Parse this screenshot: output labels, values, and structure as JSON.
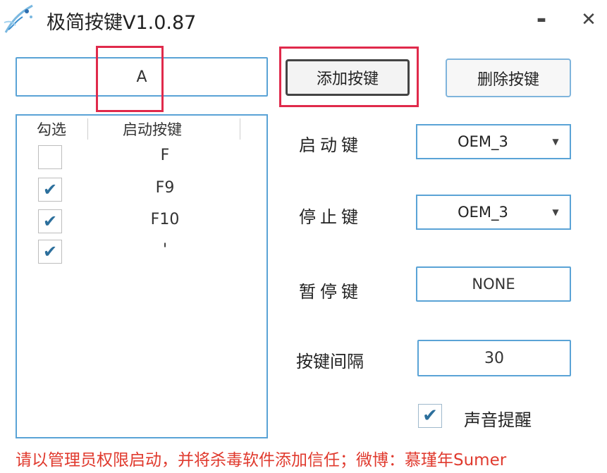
{
  "window": {
    "title": "极简按键V1.0.87",
    "minimize_label": "▬",
    "close_label": "✕"
  },
  "key_input": {
    "value": "A"
  },
  "buttons": {
    "add_label": "添加按键",
    "delete_label": "删除按键"
  },
  "list": {
    "headers": {
      "check": "勾选",
      "key": "启动按键"
    },
    "rows": [
      {
        "checked": false,
        "key": "F"
      },
      {
        "checked": true,
        "key": "F9"
      },
      {
        "checked": true,
        "key": "F10"
      },
      {
        "checked": true,
        "key": "'"
      }
    ]
  },
  "settings": {
    "start_label": "启动键",
    "start_value": "OEM_3",
    "stop_label": "停止键",
    "stop_value": "OEM_3",
    "pause_label": "暂停键",
    "pause_value": "NONE",
    "interval_label": "按键间隔",
    "interval_value": "30"
  },
  "sound": {
    "checked": true,
    "label": "声音提醒"
  },
  "footer": {
    "text": "请以管理员权限启动，并将杀毒软件添加信任；微博：慕瑾年Sumer"
  },
  "colors": {
    "accent": "#5aa3d6",
    "highlight": "#e02a4b",
    "footer": "#e03a2e",
    "check": "#2c6f9c"
  },
  "icons": {
    "app": "feather-splash-icon",
    "check": "checkmark-icon",
    "dropdown": "triangle-down-icon"
  }
}
